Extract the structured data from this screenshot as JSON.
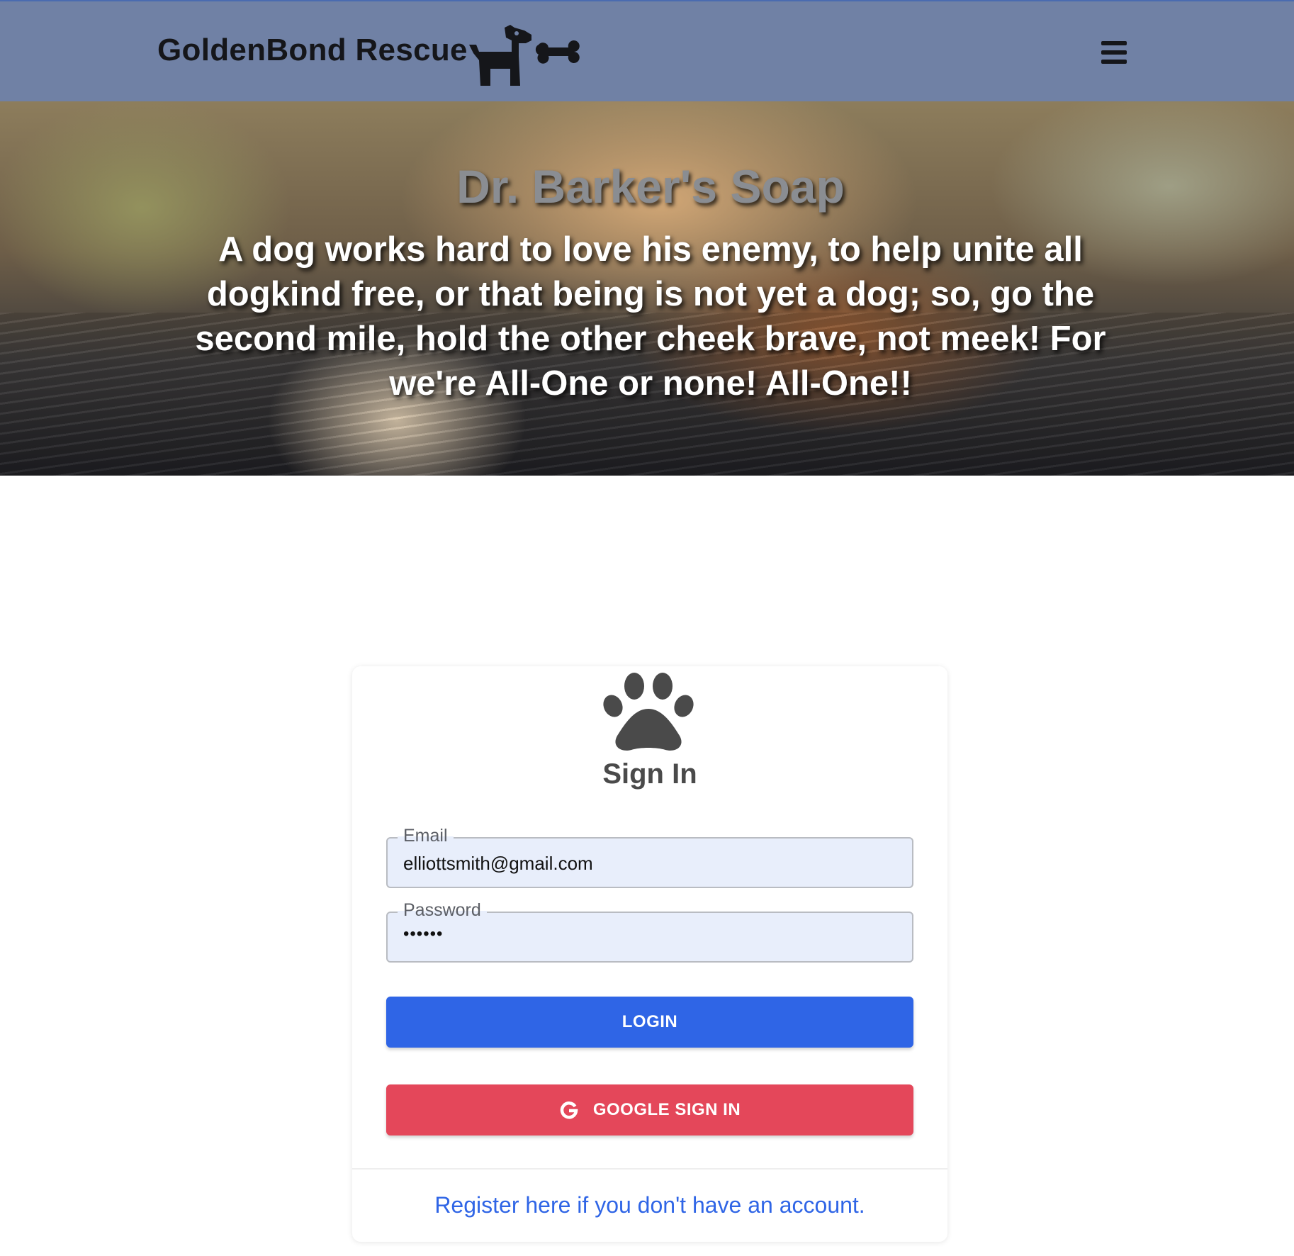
{
  "navbar": {
    "brand": "GoldenBond Rescue",
    "logo_icon": "dog-with-bone-icon",
    "menu_icon": "hamburger-menu-icon",
    "background_color": "#7081a5"
  },
  "hero": {
    "title": "Dr. Barker's Soap",
    "quote": "A dog works hard to love his enemy, to help unite all dogkind free, or that being is not yet a dog; so, go the second mile, hold the other cheek brave, not meek! For we're All-One or none! All-One!!"
  },
  "signin": {
    "icon": "paw-icon",
    "title": "Sign In",
    "email": {
      "label": "Email",
      "value": "elliottsmith@gmail.com"
    },
    "password": {
      "label": "Password",
      "masked_value": "••••••"
    },
    "login_button": "LOGIN",
    "google_button": "GOOGLE SIGN IN",
    "google_icon": "google-g-icon",
    "register_link": "Register here if you don't have an account."
  },
  "colors": {
    "primary": "#2f65e6",
    "google": "#e4475a",
    "field_bg": "#e8eefb"
  }
}
